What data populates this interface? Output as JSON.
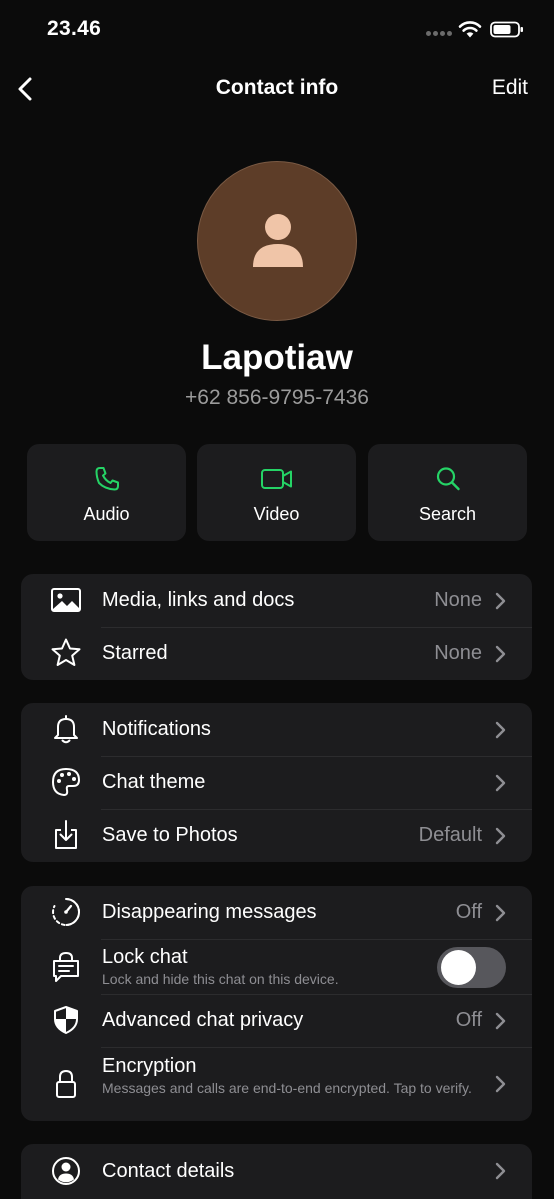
{
  "status_bar": {
    "time": "23.46"
  },
  "nav": {
    "title": "Contact info",
    "edit_label": "Edit"
  },
  "contact": {
    "name": "Lapotiaw",
    "phone": "+62 856-9795-7436"
  },
  "accent_color": "#25d366",
  "actions": [
    {
      "label": "Audio",
      "icon": "phone-icon"
    },
    {
      "label": "Video",
      "icon": "video-icon"
    },
    {
      "label": "Search",
      "icon": "search-icon"
    }
  ],
  "group_media": [
    {
      "label": "Media, links and docs",
      "value": "None",
      "icon": "image-icon"
    },
    {
      "label": "Starred",
      "value": "None",
      "icon": "star-icon"
    }
  ],
  "group_settings": [
    {
      "label": "Notifications",
      "value": "",
      "icon": "bell-icon"
    },
    {
      "label": "Chat theme",
      "value": "",
      "icon": "palette-icon"
    },
    {
      "label": "Save to Photos",
      "value": "Default",
      "icon": "save-icon"
    }
  ],
  "group_privacy": {
    "disappearing": {
      "label": "Disappearing messages",
      "value": "Off",
      "icon": "timer-icon"
    },
    "lock_chat": {
      "label": "Lock chat",
      "subtitle": "Lock and hide this chat on this device.",
      "enabled": false,
      "icon": "lock-chat-icon"
    },
    "advanced_privacy": {
      "label": "Advanced chat privacy",
      "value": "Off",
      "icon": "shield-icon"
    },
    "encryption": {
      "label": "Encryption",
      "subtitle": "Messages and calls are end-to-end encrypted. Tap to verify.",
      "icon": "lock-icon"
    }
  },
  "contact_details": {
    "label": "Contact details",
    "icon": "person-circle-icon"
  }
}
